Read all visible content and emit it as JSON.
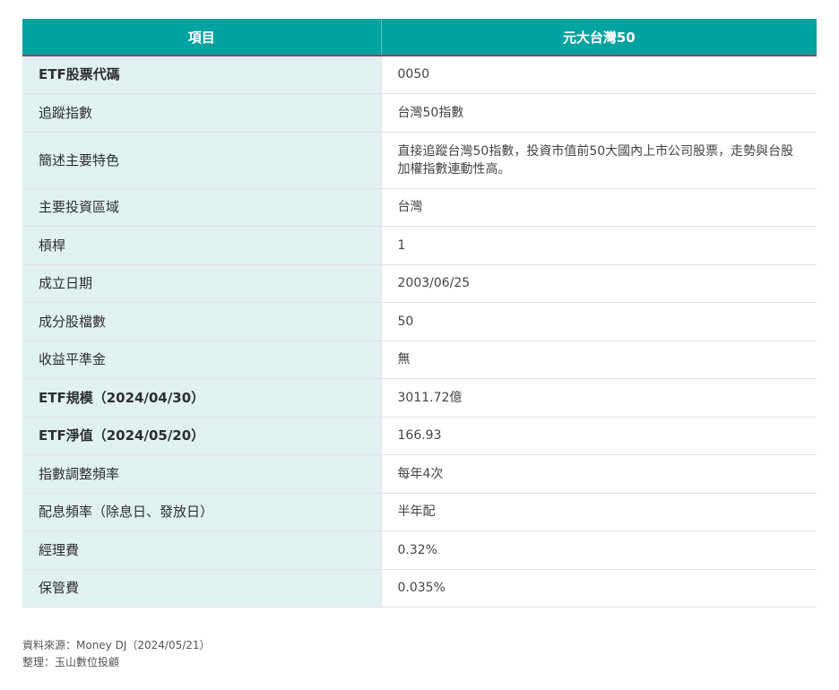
{
  "table": {
    "headers": [
      "項目",
      "元大台灣50"
    ],
    "rows": [
      {
        "label": "ETF股票代碼",
        "value": "0050"
      },
      {
        "label": "追蹤指數",
        "value": "台灣50指數"
      },
      {
        "label": "簡述主要特色",
        "value": "直接追蹤台灣50指數，投資市值前50大國內上市公司股票，走勢與台股加權指數連動性高。"
      },
      {
        "label": "主要投資區域",
        "value": "台灣"
      },
      {
        "label": "槓桿",
        "value": "1"
      },
      {
        "label": "成立日期",
        "value": "2003/06/25"
      },
      {
        "label": "成分股檔數",
        "value": "50"
      },
      {
        "label": "收益平準金",
        "value": "無"
      },
      {
        "label": "ETF規模（2024/04/30）",
        "value": "3011.72億"
      },
      {
        "label": "ETF淨值（2024/05/20）",
        "value": "166.93"
      },
      {
        "label": "指數調整頻率",
        "value": "每年4次"
      },
      {
        "label": "配息頻率（除息日、發放日）",
        "value": "半年配"
      },
      {
        "label": "經理費",
        "value": "0.32%"
      },
      {
        "label": "保管費",
        "value": "0.035%"
      }
    ]
  },
  "footer": {
    "source": "資料來源：Money DJ（2024/05/21）",
    "compiled_by": "整理：玉山數位投顧"
  },
  "colors": {
    "header_bg": "#00a3a0",
    "header_underline": "#b0306a",
    "label_bg": "#e1f1f1"
  }
}
